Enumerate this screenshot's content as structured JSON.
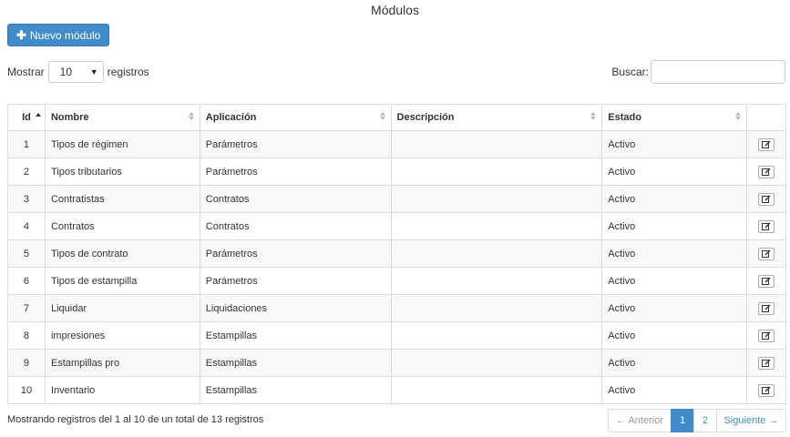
{
  "page": {
    "title": "Módulos"
  },
  "toolbar": {
    "new_label": "Nuevo módulo",
    "new_icon": "plus-icon"
  },
  "length": {
    "prefix": "Mostrar",
    "value": "10",
    "suffix": "registros"
  },
  "search": {
    "label": "Buscar:",
    "value": ""
  },
  "table": {
    "columns": [
      "Id",
      "Nombre",
      "Aplicación",
      "Descripción",
      "Estado",
      ""
    ],
    "rows": [
      {
        "id": "1",
        "nombre": "Tipos de régimen",
        "aplicacion": "Parámetros",
        "descripcion": "",
        "estado": "Activo"
      },
      {
        "id": "2",
        "nombre": "Tipos tributarios",
        "aplicacion": "Parámetros",
        "descripcion": "",
        "estado": "Activo"
      },
      {
        "id": "3",
        "nombre": "Contratistas",
        "aplicacion": "Contratos",
        "descripcion": "",
        "estado": "Activo"
      },
      {
        "id": "4",
        "nombre": "Contratos",
        "aplicacion": "Contratos",
        "descripcion": "",
        "estado": "Activo"
      },
      {
        "id": "5",
        "nombre": "Tipos de contrato",
        "aplicacion": "Parámetros",
        "descripcion": "",
        "estado": "Activo"
      },
      {
        "id": "6",
        "nombre": "Tipos de estampilla",
        "aplicacion": "Parámetros",
        "descripcion": "",
        "estado": "Activo"
      },
      {
        "id": "7",
        "nombre": "Liquidar",
        "aplicacion": "Liquidaciones",
        "descripcion": "",
        "estado": "Activo"
      },
      {
        "id": "8",
        "nombre": "impresiones",
        "aplicacion": "Estampillas",
        "descripcion": "",
        "estado": "Activo"
      },
      {
        "id": "9",
        "nombre": "Estampillas pro",
        "aplicacion": "Estampillas",
        "descripcion": "",
        "estado": "Activo"
      },
      {
        "id": "10",
        "nombre": "Inventario",
        "aplicacion": "Estampillas",
        "descripcion": "",
        "estado": "Activo"
      }
    ],
    "edit_icon": "edit-icon"
  },
  "footer": {
    "info": "Mostrando registros del 1 al 10 de un total de 13 registros",
    "prev": "← Anterior",
    "pages": [
      "1",
      "2"
    ],
    "next": "Siguiente →",
    "current_page": 1
  },
  "colors": {
    "primary": "#428bca",
    "stripe": "#f9f9f9",
    "border": "#dddddd"
  }
}
